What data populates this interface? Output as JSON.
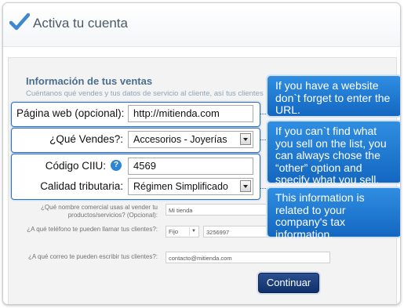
{
  "header": {
    "title": "Activa tu cuenta"
  },
  "section": {
    "title": "Información de tus ventas",
    "subtitle": "Cuéntanos qué vendes y tus datos de servicio al cliente, así tus clientes"
  },
  "fields": {
    "website": {
      "label": "Página web (opcional):",
      "value": "http://mitienda.com"
    },
    "sells": {
      "label": "¿Qué Vendes?:",
      "value": "Accesorios - Joyerías"
    },
    "ciiu": {
      "label": "Código CIIU:",
      "value": "4569",
      "help": "?"
    },
    "tax": {
      "label": "Calidad tributaria:",
      "value": "Régimen Simplificado"
    },
    "trade_name": {
      "label_line1": "¿Qué nombre comercial usas al vender tu",
      "label_line2": "productos/servicios? (Opcional):",
      "value": "Mi tienda"
    },
    "phone": {
      "label": "¿A qué teléfono te pueden llamar tus clientes?:",
      "type_value": "Fijo",
      "value": "3256997"
    },
    "email": {
      "label": "¿A qué correo te pueden escribir tus clientes?:",
      "value": "contacto@mitienda.com"
    }
  },
  "tooltips": {
    "website": "If you have a website don`t forget to enter the URL.",
    "sells": "If you can`t find what you sell on the list, you can always chose the “other” option and specify what you sell.",
    "tax": "This information is related to your company's tax information."
  },
  "actions": {
    "continue_label": "Continuar"
  },
  "colors": {
    "accent": "#2a72c6",
    "tooltip": "#1f7fd8",
    "button": "#1a3d7a"
  }
}
